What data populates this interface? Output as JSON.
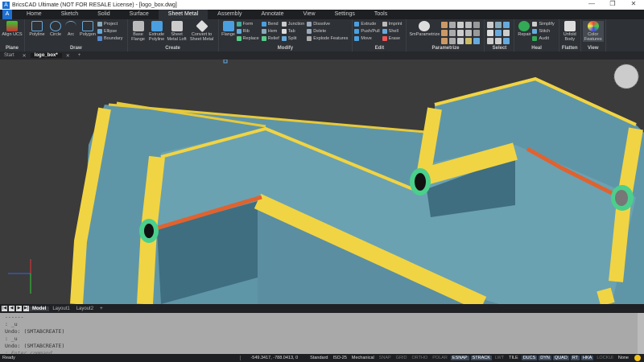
{
  "window": {
    "title": "BricsCAD Ultimate (NOT FOR RESALE License) - [logo_box.dwg]",
    "controls": [
      "—",
      "❐",
      "✕"
    ]
  },
  "menu_tabs": [
    "Home",
    "Sketch",
    "Solid",
    "Surface",
    "Sheet Metal",
    "Assembly",
    "Annotate",
    "View",
    "Settings",
    "Tools"
  ],
  "active_tab": "Sheet Metal",
  "ribbon": {
    "plane": {
      "title": "Plane",
      "buttons": [
        "Align UCS"
      ]
    },
    "draw": {
      "title": "Draw",
      "buttons": [
        "Polyline",
        "Circle",
        "Arc",
        "Polygon"
      ],
      "small": [
        "Project",
        "Ellipse",
        "Boundary"
      ]
    },
    "create": {
      "title": "Create",
      "buttons": [
        "Base Flange",
        "Extrude Polyline",
        "Sheet Metal Loft",
        "Convert to Sheet Metal"
      ]
    },
    "modify": {
      "title": "Modify",
      "buttons": [
        "Flange"
      ],
      "small": [
        "Form",
        "Rib",
        "Replace",
        "Bend",
        "Hem",
        "Relief",
        "Junction",
        "Tab",
        "Split",
        "Dissolve",
        "Delete",
        "Explode Features"
      ]
    },
    "edit": {
      "title": "Edit",
      "small": [
        "Extrude",
        "Push/Pull",
        "Move",
        "Imprint",
        "Shell",
        "Erase"
      ]
    },
    "parametrize": {
      "title": "Parametrize",
      "buttons": [
        "SmParametrize"
      ]
    },
    "select": {
      "title": "Select"
    },
    "heal": {
      "title": "Heal",
      "buttons": [
        "Repair"
      ],
      "small": [
        "Simplify",
        "Stitch",
        "Audit"
      ]
    },
    "flatten": {
      "title": "Flatten",
      "buttons": [
        "Unfold Body"
      ]
    },
    "view": {
      "title": "View",
      "buttons": [
        "Color Features"
      ]
    }
  },
  "doc_tabs": [
    "Start",
    "logo_box*"
  ],
  "layout_tabs": [
    "Model",
    "Layout1",
    "Layout2"
  ],
  "command_history": [
    "------",
    ": _u",
    "Undo: (SMTABCREATE)",
    ": _u",
    "Undo: (SMTABCREATE)"
  ],
  "command_placeholder": ": Enter command",
  "status": {
    "ready": "Ready",
    "coords": "-549.3417, -788.0413, 0",
    "items": [
      "Standard",
      "ISO-25",
      "Mechanical",
      "SNAP",
      "GRID",
      "ORTHO",
      "POLAR",
      "ESNAP",
      "STRACK",
      "LWT",
      "TILE",
      "DUCS",
      "DYN",
      "QUAD",
      "RT",
      "HKA",
      "LOCKUI",
      "None"
    ],
    "on": [
      "ESNAP",
      "STRACK",
      "DUCS",
      "DYN",
      "QUAD",
      "RT",
      "HKA"
    ],
    "plain": [
      "Standard",
      "ISO-25",
      "Mechanical",
      "TILE",
      "None"
    ]
  },
  "colors": {
    "surface": "#5e96a8",
    "tube": "#f1d443",
    "edge": "#e0622f",
    "background": "#3b3b3b"
  }
}
